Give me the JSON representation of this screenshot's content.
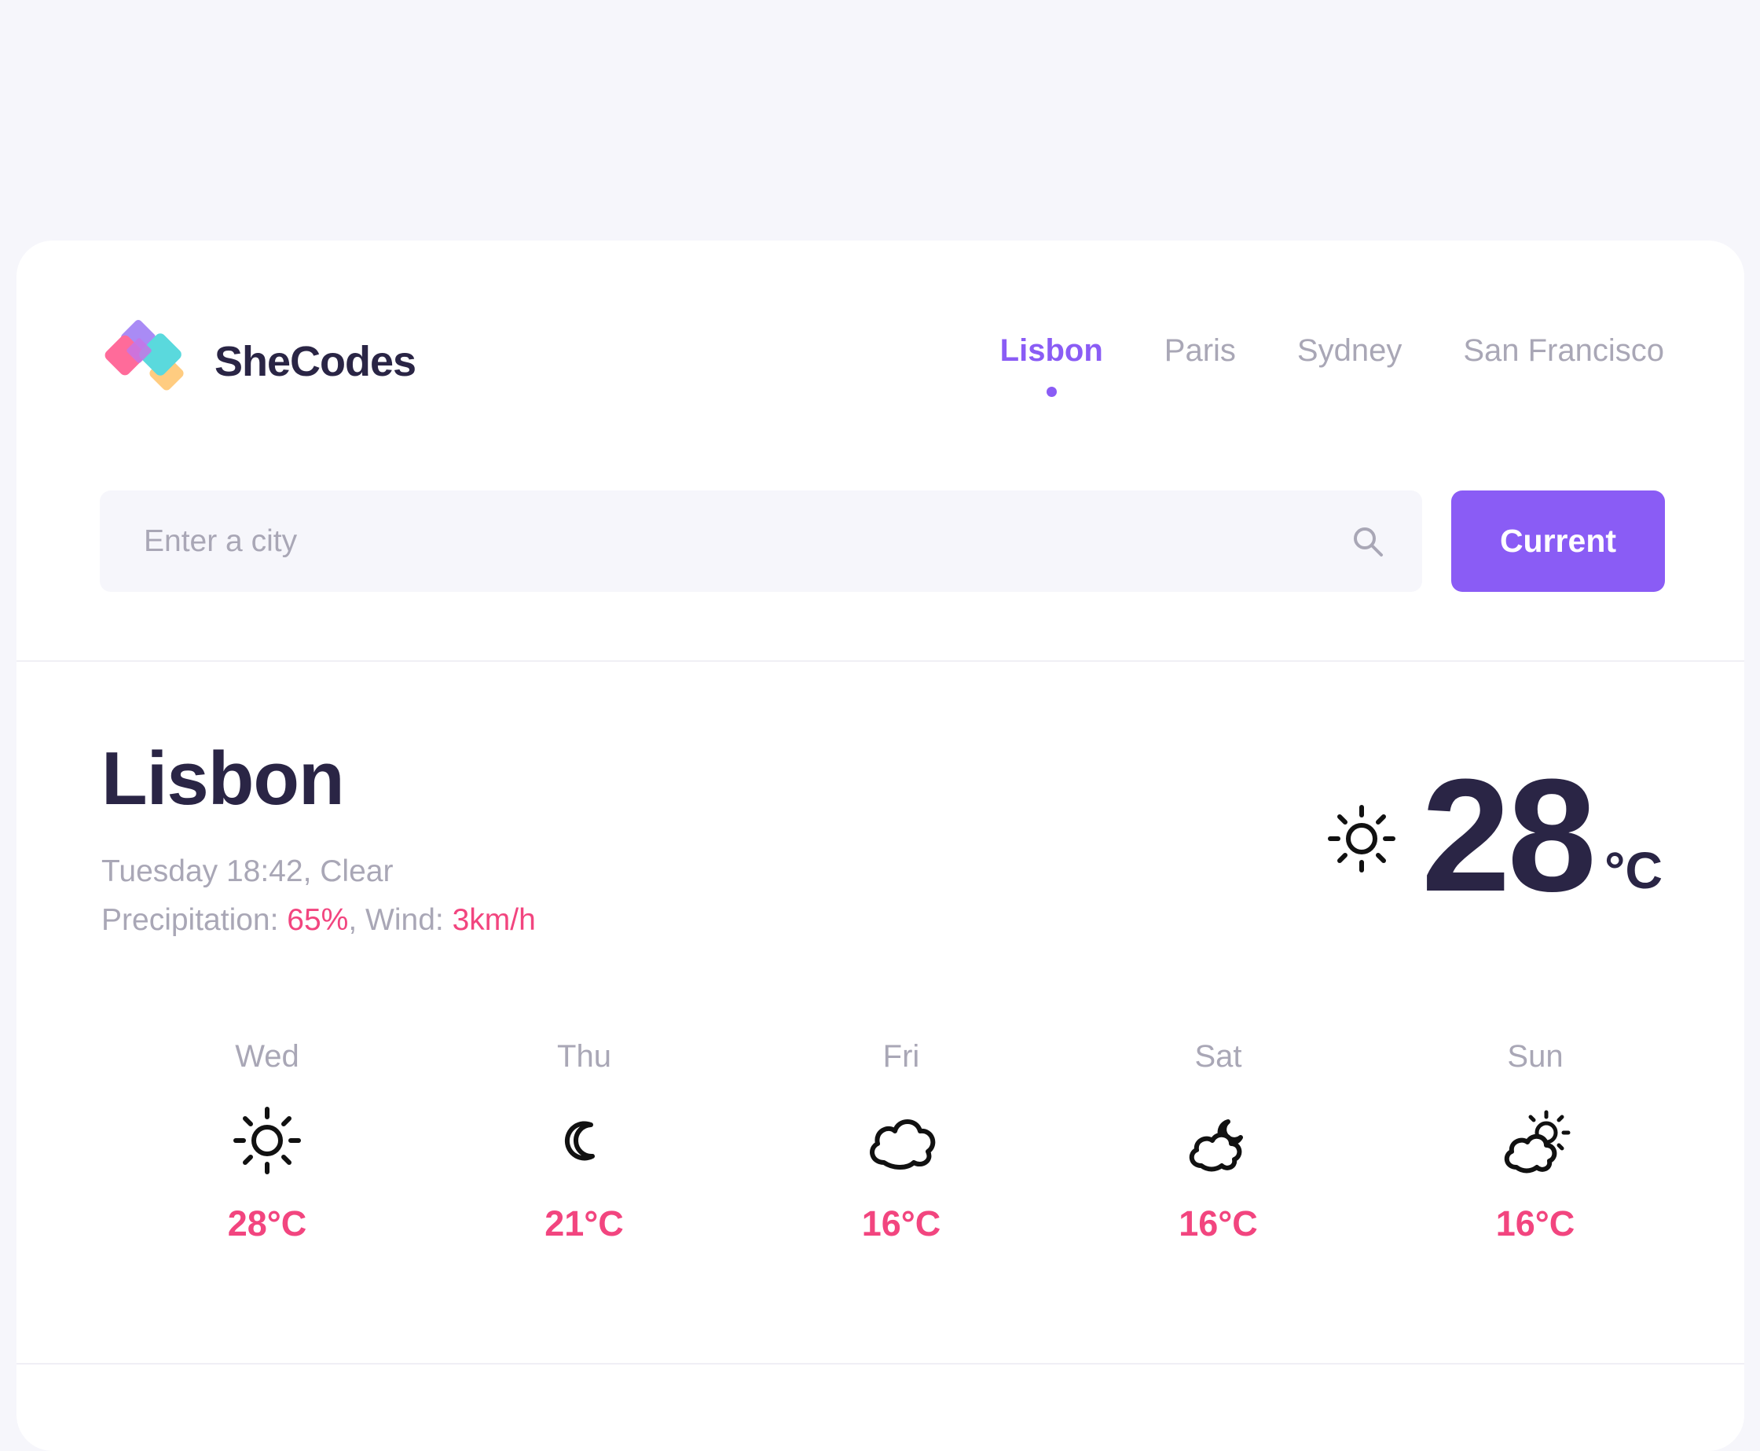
{
  "brand": {
    "name": "SheCodes"
  },
  "nav": {
    "items": [
      {
        "label": "Lisbon",
        "active": true
      },
      {
        "label": "Paris",
        "active": false
      },
      {
        "label": "Sydney",
        "active": false
      },
      {
        "label": "San Francisco",
        "active": false
      }
    ]
  },
  "search": {
    "placeholder": "Enter a city",
    "value": "",
    "button_label": "Current"
  },
  "current": {
    "city": "Lisbon",
    "day_time_condition": "Tuesday 18:42, Clear",
    "precipitation_label": "Precipitation: ",
    "precipitation_value": "65%",
    "wind_label": ", Wind: ",
    "wind_value": "3km/h",
    "temperature": "28",
    "unit": "°C",
    "icon": "sun-icon"
  },
  "forecast": [
    {
      "day": "Wed",
      "temp": "28°C",
      "icon": "sun-icon"
    },
    {
      "day": "Thu",
      "temp": "21°C",
      "icon": "moon-icon"
    },
    {
      "day": "Fri",
      "temp": "16°C",
      "icon": "cloud-icon"
    },
    {
      "day": "Sat",
      "temp": "16°C",
      "icon": "cloud-moon-icon"
    },
    {
      "day": "Sun",
      "temp": "16°C",
      "icon": "partly-sunny-icon"
    }
  ],
  "colors": {
    "accent": "#8a5cf5",
    "highlight": "#f2457f",
    "text": "#2a2545",
    "muted": "#a9a7b6",
    "page_bg": "#f6f6fb"
  }
}
